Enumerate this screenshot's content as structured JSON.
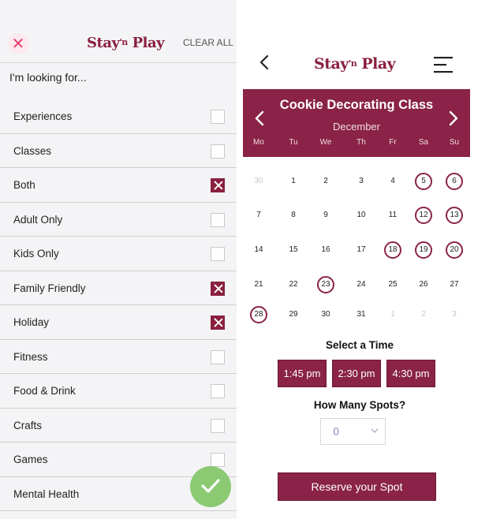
{
  "filter_panel": {
    "logo_main": "Stay",
    "logo_mid": "'n",
    "logo_end": "Play",
    "clear_all_label": "CLEAR ALL",
    "close_icon": "close-icon",
    "prompt": "I'm looking for...",
    "filters": [
      {
        "label": "Experiences",
        "checked": false
      },
      {
        "label": "Classes",
        "checked": false
      },
      {
        "label": "Both",
        "checked": true
      },
      {
        "label": "Adult Only",
        "checked": false
      },
      {
        "label": "Kids Only",
        "checked": false
      },
      {
        "label": "Family Friendly",
        "checked": true
      },
      {
        "label": "Holiday",
        "checked": true
      },
      {
        "label": "Fitness",
        "checked": false
      },
      {
        "label": "Food & Drink",
        "checked": false
      },
      {
        "label": "Crafts",
        "checked": false
      },
      {
        "label": "Games",
        "checked": false
      },
      {
        "label": "Mental Health",
        "checked": false
      }
    ],
    "apply_icon": "check-icon"
  },
  "booking_panel": {
    "logo_main": "Stay",
    "logo_mid": "'n",
    "logo_end": "Play",
    "class_title": "Cookie Decorating Class",
    "month": "December",
    "weekdays": [
      "Mo",
      "Tu",
      "We",
      "Th",
      "Fr",
      "Sa",
      "Su"
    ],
    "weeks": [
      [
        {
          "d": "30",
          "s": "muted"
        },
        {
          "d": "1",
          "s": ""
        },
        {
          "d": "2",
          "s": ""
        },
        {
          "d": "3",
          "s": ""
        },
        {
          "d": "4",
          "s": ""
        },
        {
          "d": "5",
          "s": "avail"
        },
        {
          "d": "6",
          "s": "avail"
        }
      ],
      [
        {
          "d": "7",
          "s": ""
        },
        {
          "d": "8",
          "s": ""
        },
        {
          "d": "9",
          "s": ""
        },
        {
          "d": "10",
          "s": ""
        },
        {
          "d": "11",
          "s": ""
        },
        {
          "d": "12",
          "s": "avail"
        },
        {
          "d": "13",
          "s": "avail"
        }
      ],
      [
        {
          "d": "14",
          "s": ""
        },
        {
          "d": "15",
          "s": ""
        },
        {
          "d": "16",
          "s": ""
        },
        {
          "d": "17",
          "s": ""
        },
        {
          "d": "18",
          "s": "avail"
        },
        {
          "d": "19",
          "s": "avail"
        },
        {
          "d": "20",
          "s": "avail"
        }
      ],
      [
        {
          "d": "21",
          "s": ""
        },
        {
          "d": "22",
          "s": ""
        },
        {
          "d": "23",
          "s": "avail"
        },
        {
          "d": "24",
          "s": ""
        },
        {
          "d": "25",
          "s": ""
        },
        {
          "d": "26",
          "s": ""
        },
        {
          "d": "27",
          "s": ""
        }
      ],
      [
        {
          "d": "28",
          "s": "avail"
        },
        {
          "d": "29",
          "s": ""
        },
        {
          "d": "30",
          "s": ""
        },
        {
          "d": "31",
          "s": ""
        },
        {
          "d": "1",
          "s": "muted"
        },
        {
          "d": "2",
          "s": "muted"
        },
        {
          "d": "3",
          "s": "muted"
        }
      ]
    ],
    "select_time_label": "Select a Time",
    "times": [
      "1:45 pm",
      "2:30 pm",
      "4:30 pm"
    ],
    "spots_label": "How Many Spots?",
    "spots_value": "0",
    "reserve_label": "Reserve your Spot"
  },
  "colors": {
    "brand": "#8a2347",
    "accent_green": "#8bca73",
    "close_pink": "#e23f6b"
  }
}
